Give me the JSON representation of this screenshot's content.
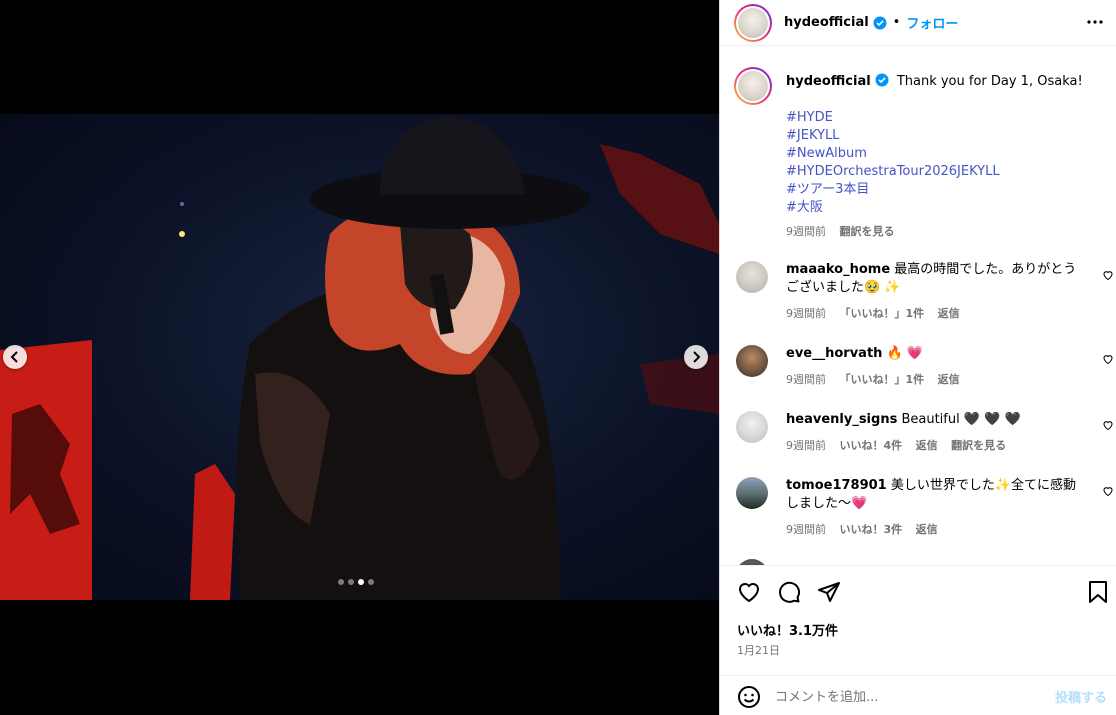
{
  "post": {
    "username": "hydeofficial",
    "follow_label": "フォロー",
    "separator": "•",
    "caption": "Thank you for Day 1, Osaka!",
    "hashtags": [
      "#HYDE",
      "#JEKYLL",
      "#NewAlbum",
      "#HYDEOrchestraTour2026JEKYLL",
      "#ツアー3本目",
      "#大阪"
    ],
    "time": "9週間前",
    "translate_label": "翻訳を見る",
    "likes": "いいね！3.1万件",
    "date": "1月21日"
  },
  "comments": [
    {
      "user": "maaako_home",
      "text": "最高の時間でした。ありがとうございました🥹 ✨",
      "time": "9週間前",
      "likes": "「いいね！」1件",
      "reply": "返信"
    },
    {
      "user": "eve__horvath",
      "text": "🔥 💗",
      "time": "9週間前",
      "likes": "「いいね！」1件",
      "reply": "返信"
    },
    {
      "user": "heavenly_signs",
      "text": "Beautiful 🖤 🖤 🖤",
      "time": "9週間前",
      "likes": "いいね！4件",
      "reply": "返信",
      "translate": "翻訳を見る"
    },
    {
      "user": "tomoe178901",
      "text": "美しい世界でした✨全てに感動しました〜💗",
      "time": "9週間前",
      "likes": "いいね！3件",
      "reply": "返信"
    }
  ],
  "composer": {
    "placeholder": "コメントを追加...",
    "post_label": "投稿する"
  },
  "carousel": {
    "total": 4,
    "active_index": 2
  },
  "icons": {
    "verified": "verified-badge-icon",
    "more": "more-options-icon",
    "like": "heart-icon",
    "comment": "comment-icon",
    "share": "share-icon",
    "save": "bookmark-icon",
    "emoji": "emoji-icon",
    "prev": "chevron-left-icon",
    "next": "chevron-right-icon"
  },
  "colors": {
    "link": "#4553c4",
    "accent": "#0095f6",
    "verified": "#0095f6",
    "stage_red": "#d4201a"
  }
}
